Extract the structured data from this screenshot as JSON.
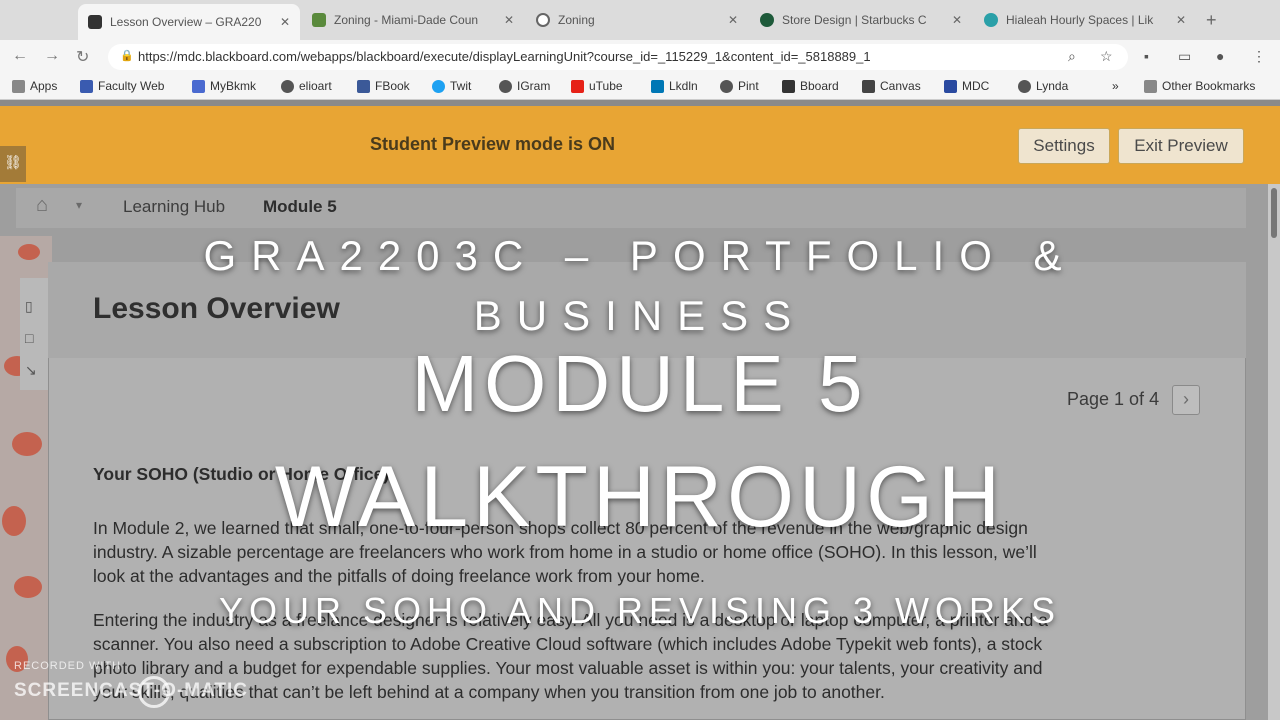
{
  "browser": {
    "tabs": [
      {
        "title": "Lesson Overview – GRA220",
        "color": "#333333",
        "active": true
      },
      {
        "title": "Zoning - Miami-Dade Coun",
        "color": "#5a8a3c",
        "active": false
      },
      {
        "title": "Zoning",
        "color": "#666666",
        "active": false
      },
      {
        "title": "Store Design | Starbucks C",
        "color": "#1e5a3a",
        "active": false
      },
      {
        "title": "Hialeah Hourly Spaces | Lik",
        "color": "#2aa0a8",
        "active": false
      }
    ],
    "url": "https://mdc.blackboard.com/webapps/blackboard/execute/displayLearningUnit?course_id=_115229_1&content_id=_5818889_1",
    "bookmarks": [
      {
        "label": "Apps",
        "color": "#888888"
      },
      {
        "label": "Faculty Web",
        "color": "#3a5bb0"
      },
      {
        "label": "MyBkmk",
        "color": "#4a6ad0"
      },
      {
        "label": "elioart",
        "color": "#555555"
      },
      {
        "label": "FBook",
        "color": "#3b5998"
      },
      {
        "label": "Twit",
        "color": "#1da1f2"
      },
      {
        "label": "IGram",
        "color": "#555555"
      },
      {
        "label": "uTube",
        "color": "#e62117"
      },
      {
        "label": "Lkdln",
        "color": "#0077b5"
      },
      {
        "label": "Pint",
        "color": "#555555"
      },
      {
        "label": "Bboard",
        "color": "#333333"
      },
      {
        "label": "Canvas",
        "color": "#444444"
      },
      {
        "label": "MDC",
        "color": "#2a4aa0"
      },
      {
        "label": "Lynda",
        "color": "#555555"
      }
    ],
    "more_bookmarks": "»",
    "other_bookmarks": "Other Bookmarks"
  },
  "banner": {
    "text": "Student Preview mode is ON",
    "settings_label": "Settings",
    "exit_label": "Exit Preview"
  },
  "breadcrumb": {
    "hub": "Learning Hub",
    "module": "Module 5"
  },
  "lesson": {
    "title": "Lesson Overview",
    "pager": "Page 1 of 4",
    "section_heading": "Your SOHO (Studio or Home Office)",
    "para1": [
      "In Module 2, we learned that small, one-to-four-person shops collect 80 percent of the revenue in the web/graphic design",
      "industry. A sizable percentage are freelancers who work from home in a studio or home office (SOHO). In this lesson, we’ll",
      "look at the advantages and the pitfalls of doing freelance work from your home."
    ],
    "para2": [
      "Entering the industry as a freelance designer is relatively easy. All you need is a desktop or laptop computer, a printer and a",
      "scanner. You also need a subscription to Adobe Creative Cloud software (which includes Adobe Typekit web fonts), a stock",
      "photo library and a budget for expendable supplies. Your most valuable asset is within you: your talents, your creativity and",
      "your skills, qualities that can’t be left behind at a company when you transition from one job to another."
    ]
  },
  "overlay": {
    "line1": "GRA2203C – PORTFOLIO &",
    "line2": "BUSINESS",
    "line3": "MODULE 5",
    "line4": "WALKTHROUGH",
    "line5": "YOUR SOHO AND REVISING 3 WORKS"
  },
  "watermark": {
    "line1": "RECORDED WITH",
    "line2": "SCREENCAST-O-MATIC"
  }
}
